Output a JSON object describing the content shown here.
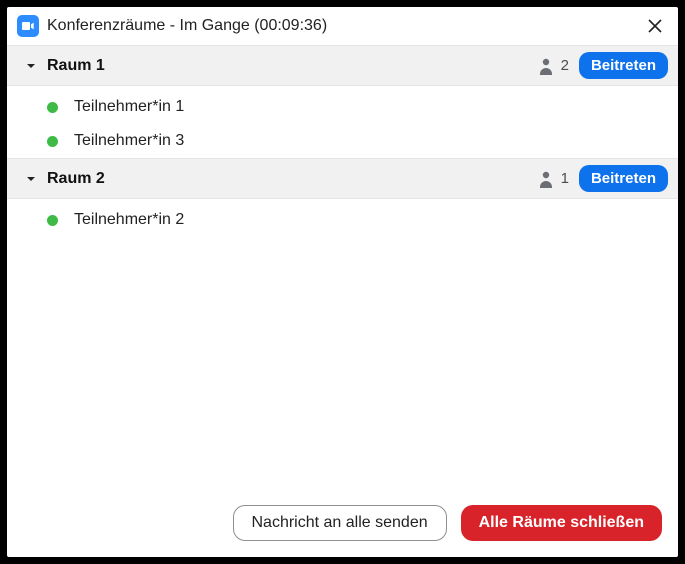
{
  "titlebar": {
    "title": "Konferenzräume - Im Gange (00:09:36)"
  },
  "rooms": [
    {
      "name": "Raum 1",
      "count": "2",
      "join_label": "Beitreten",
      "participants": [
        {
          "name": "Teilnehmer*in 1"
        },
        {
          "name": "Teilnehmer*in 3"
        }
      ]
    },
    {
      "name": "Raum 2",
      "count": "1",
      "join_label": "Beitreten",
      "participants": [
        {
          "name": "Teilnehmer*in 2"
        }
      ]
    }
  ],
  "footer": {
    "message_all": "Nachricht an alle senden",
    "close_all": "Alle Räume schließen"
  }
}
